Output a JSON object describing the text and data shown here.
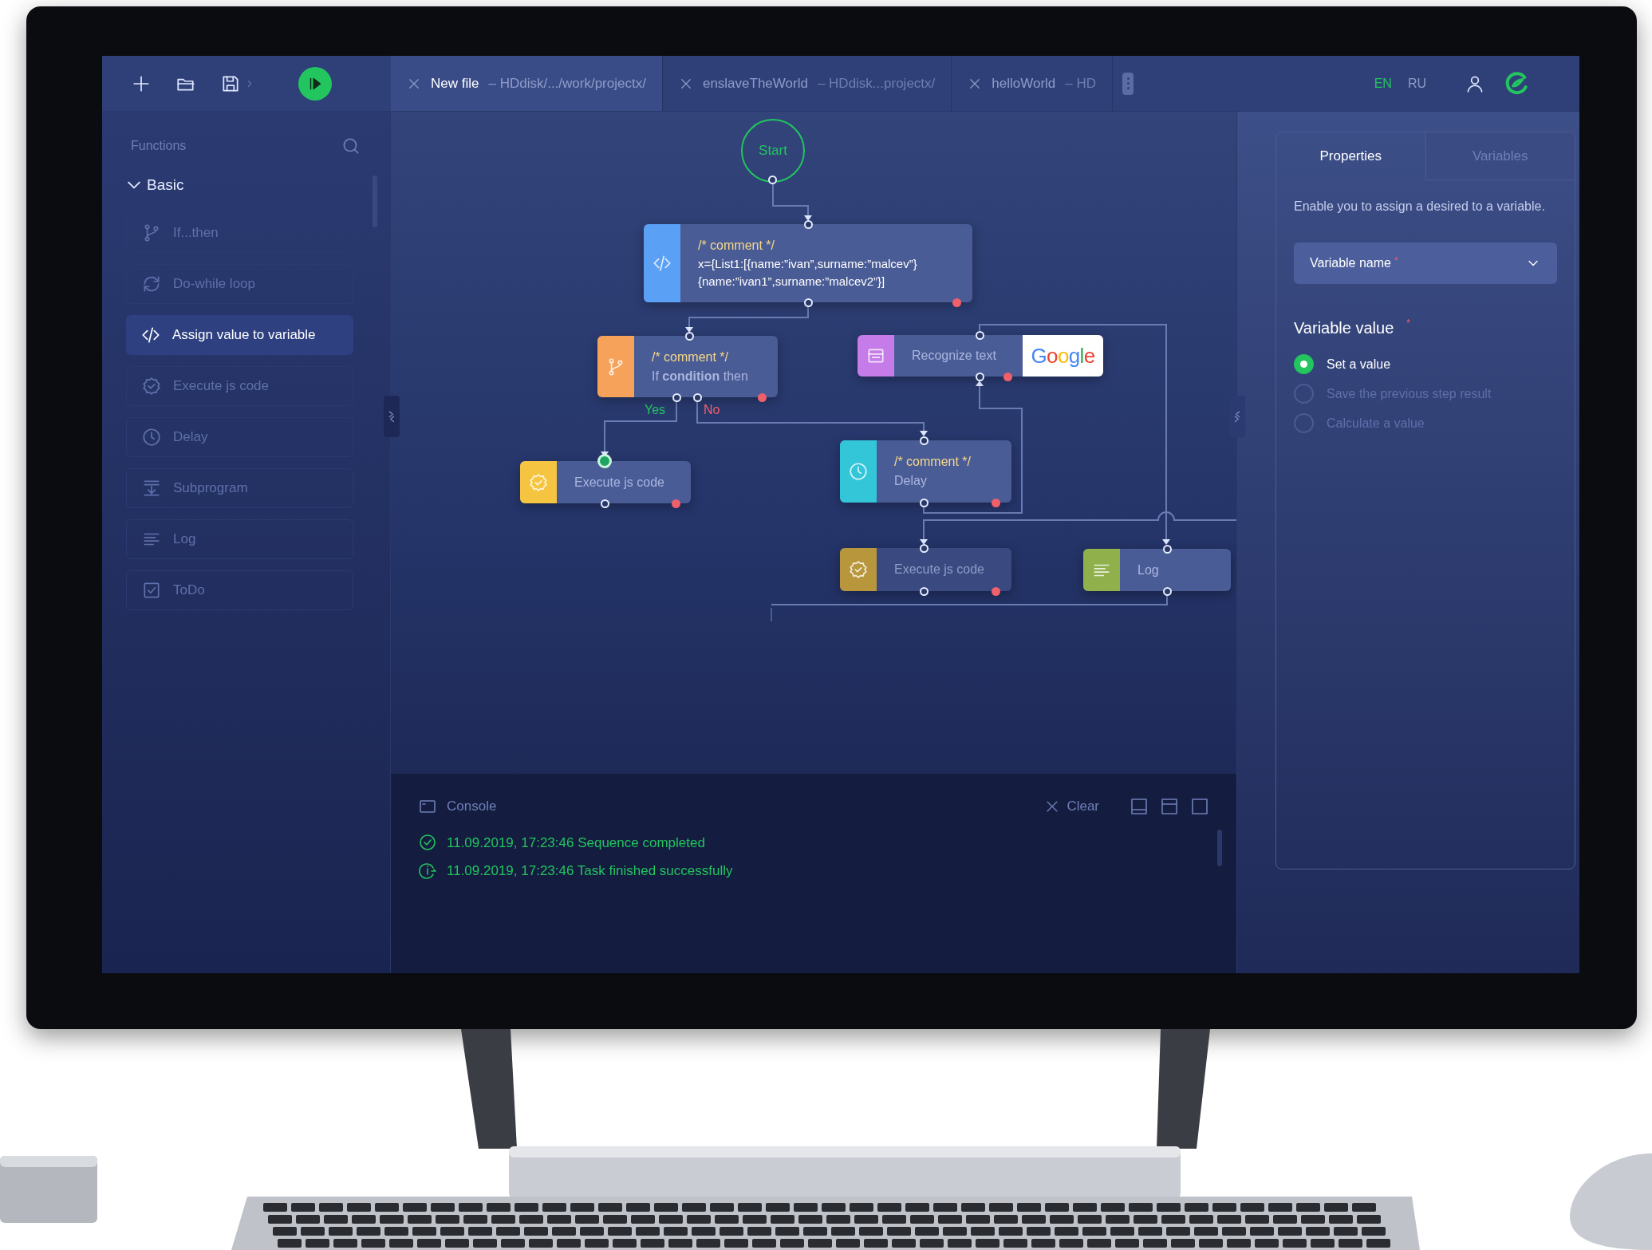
{
  "toolbar": {
    "tabs": [
      {
        "title": "New file",
        "path": "– HDdisk/.../work/projectx/",
        "selected": true
      },
      {
        "title": "enslaveTheWorld",
        "path": "– HDdisk...projectx/",
        "selected": false
      },
      {
        "title": "helloWorld",
        "path": "– HD",
        "selected": false
      }
    ],
    "languages": [
      {
        "label": "EN",
        "selected": true
      },
      {
        "label": "RU",
        "selected": false
      }
    ]
  },
  "sidebar": {
    "title": "Functions",
    "group": {
      "label": "Basic",
      "expanded": true,
      "items": [
        {
          "kind": "branch",
          "label": "If...then",
          "selected": false
        },
        {
          "kind": "loop",
          "label": "Do-while loop",
          "selected": false
        },
        {
          "kind": "code",
          "label": "Assign value to variable",
          "selected": true
        },
        {
          "kind": "check",
          "label": "Execute js code",
          "selected": false
        },
        {
          "kind": "clock",
          "label": "Delay",
          "selected": false
        },
        {
          "kind": "subprogram",
          "label": "Subprogram",
          "selected": false
        },
        {
          "kind": "log",
          "label": "Log",
          "selected": false
        },
        {
          "kind": "todo",
          "label": "ToDo",
          "selected": false
        }
      ]
    }
  },
  "canvas": {
    "start": "Start",
    "nodes": [
      {
        "kind": "code",
        "color": "#5aa0f5",
        "comment": "/* comment */",
        "text": "x={List1:[{name:”ivan”,surname:”malcev”}\n{name:”ivan1”,surname:”malcev2”}]",
        "disabled": false,
        "active": false
      },
      {
        "kind": "branch",
        "color": "#f6a25a",
        "comment": "/* comment */",
        "text": "If **condition** then",
        "branches": [
          "Yes",
          "No"
        ],
        "disabled": false,
        "active": false
      },
      {
        "kind": "recognize",
        "color": "#c57be8",
        "text": "Recognize text",
        "badge": "Google",
        "disabled": false,
        "active": false
      },
      {
        "kind": "check",
        "color": "#f5c542",
        "text": "Execute js code",
        "disabled": false,
        "active": true
      },
      {
        "kind": "clock",
        "color": "#33c6d9",
        "comment": "/* comment */",
        "text": "Delay",
        "disabled": false,
        "active": false
      },
      {
        "kind": "check",
        "color": "#b8963c",
        "text": "Execute js code",
        "disabled": true,
        "active": false
      },
      {
        "kind": "log",
        "color": "#8fb04a",
        "text": "Log",
        "disabled": false,
        "active": false
      }
    ]
  },
  "properties": {
    "tabs": [
      {
        "label": "Properties",
        "selected": true
      },
      {
        "label": "Variables",
        "selected": false
      }
    ],
    "description": "Enable you to assign a desired to a variable.",
    "variable_select": {
      "placeholder": "Variable name",
      "required_mark": "*"
    },
    "value_label": "Variable value",
    "value_required_mark": "*",
    "options": [
      {
        "label": "Set a value",
        "selected": true
      },
      {
        "label": "Save the previous step result",
        "selected": false
      },
      {
        "label": "Calculate a value",
        "selected": false
      }
    ]
  },
  "console": {
    "title": "Console",
    "clear": "Clear",
    "lines": [
      {
        "kind": "success",
        "text": "11.09.2019, 17:23:46 Sequence completed"
      },
      {
        "kind": "info",
        "text": "11.09.2019, 17:23:46 Task finished successfully"
      }
    ]
  }
}
